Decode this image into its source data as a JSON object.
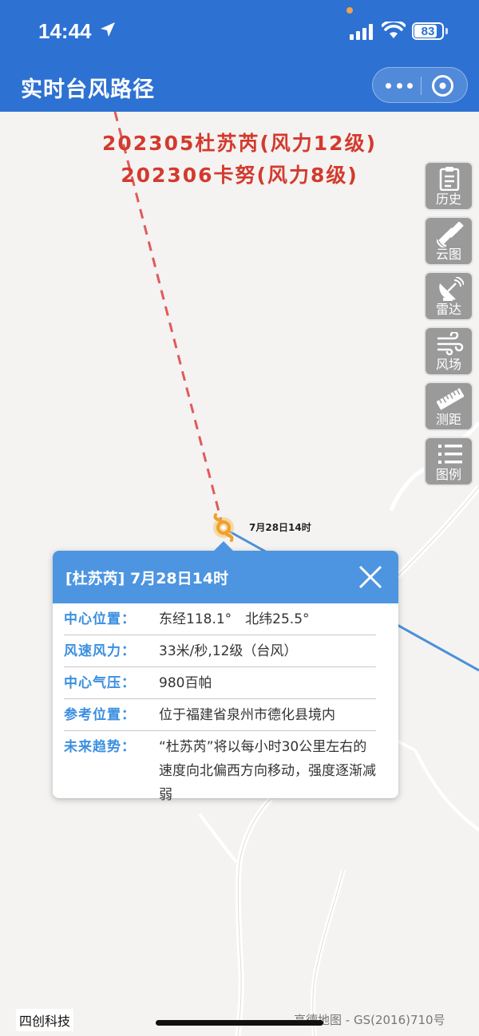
{
  "status": {
    "time": "14:44",
    "battery": "83",
    "battery_level": 0.83
  },
  "nav": {
    "title": "实时台风路径"
  },
  "storms": {
    "line1": "202305杜苏芮(风力12级)",
    "line2": "202306卡努(风力8级)"
  },
  "tools": [
    {
      "label": "历史",
      "icon": "clipboard-icon"
    },
    {
      "label": "云图",
      "icon": "satellite-icon"
    },
    {
      "label": "雷达",
      "icon": "radar-dish-icon"
    },
    {
      "label": "风场",
      "icon": "wind-icon"
    },
    {
      "label": "测距",
      "icon": "ruler-icon"
    },
    {
      "label": "图例",
      "icon": "list-icon"
    }
  ],
  "marker": {
    "time_label": "7月28日14时"
  },
  "popup": {
    "title": "[杜苏芮] 7月28日14时",
    "rows": [
      {
        "key": "中心位置：",
        "value": "东经118.1°　北纬25.5°"
      },
      {
        "key": "风速风力：",
        "value": "33米/秒,12级（台风）"
      },
      {
        "key": "中心气压：",
        "value": "980百帕"
      },
      {
        "key": "参考位置：",
        "value": "位于福建省泉州市德化县境内"
      },
      {
        "key": "未来趋势：",
        "value": "“杜苏芮”将以每小时30公里左右的速度向北偏西方向移动，强度逐渐减弱"
      }
    ]
  },
  "footer": {
    "left": "四创科技",
    "right": "高德地图 - GS(2016)710号"
  },
  "colors": {
    "header": "#2d71d2",
    "storm_title": "#d33a2e",
    "popup_header": "#4d95e0",
    "track_past": "#e05a5a",
    "track_forecast": "#4a90d9"
  }
}
